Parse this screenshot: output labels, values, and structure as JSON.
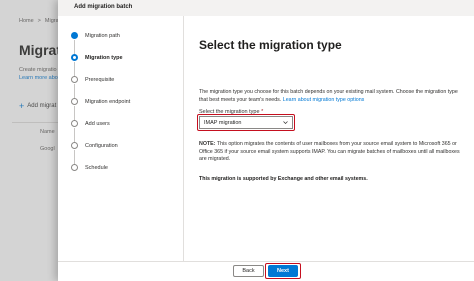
{
  "background": {
    "breadcrumb": [
      "Home",
      "Migra"
    ],
    "title": "Migratio",
    "description_line1": "Create migratio",
    "description_link": "Learn more abo",
    "add_button": "Add migrat",
    "column_name": "Name",
    "row_name": "Googl"
  },
  "panel": {
    "title": "Add migration batch"
  },
  "steps": [
    {
      "label": "Migration path",
      "state": "done"
    },
    {
      "label": "Migration type",
      "state": "current"
    },
    {
      "label": "Prerequisite",
      "state": "todo"
    },
    {
      "label": "Migration endpoint",
      "state": "todo"
    },
    {
      "label": "Add users",
      "state": "todo"
    },
    {
      "label": "Configuration",
      "state": "todo"
    },
    {
      "label": "Schedule",
      "state": "todo"
    }
  ],
  "content": {
    "heading": "Select the migration type",
    "description": "The migration type you choose for this batch depends on your existing mail system. Choose the migration type that best meets your team's needs.",
    "description_link": "Learn about migration type options",
    "field_label": "Select the migration type",
    "required_mark": "*",
    "selected_value": "IMAP migration",
    "note_prefix": "NOTE:",
    "note_text": "This option migrates the contents of user mailboxes from your source email system to Microsoft 365 or Office 365 if your source email system supports IMAP. You can migrate batches of mailboxes until all mailboxes are migrated.",
    "support_note": "This migration is supported by Exchange and other email systems."
  },
  "footer": {
    "back_label": "Back",
    "next_label": "Next"
  },
  "colors": {
    "accent": "#0078d4",
    "highlight": "#c50f1f"
  },
  "icons": {
    "add": "plus-icon",
    "dropdown": "chevron-down-icon",
    "step_done": "filled-circle-icon",
    "step_current": "ring-circle-icon",
    "step_todo": "empty-circle-icon"
  }
}
